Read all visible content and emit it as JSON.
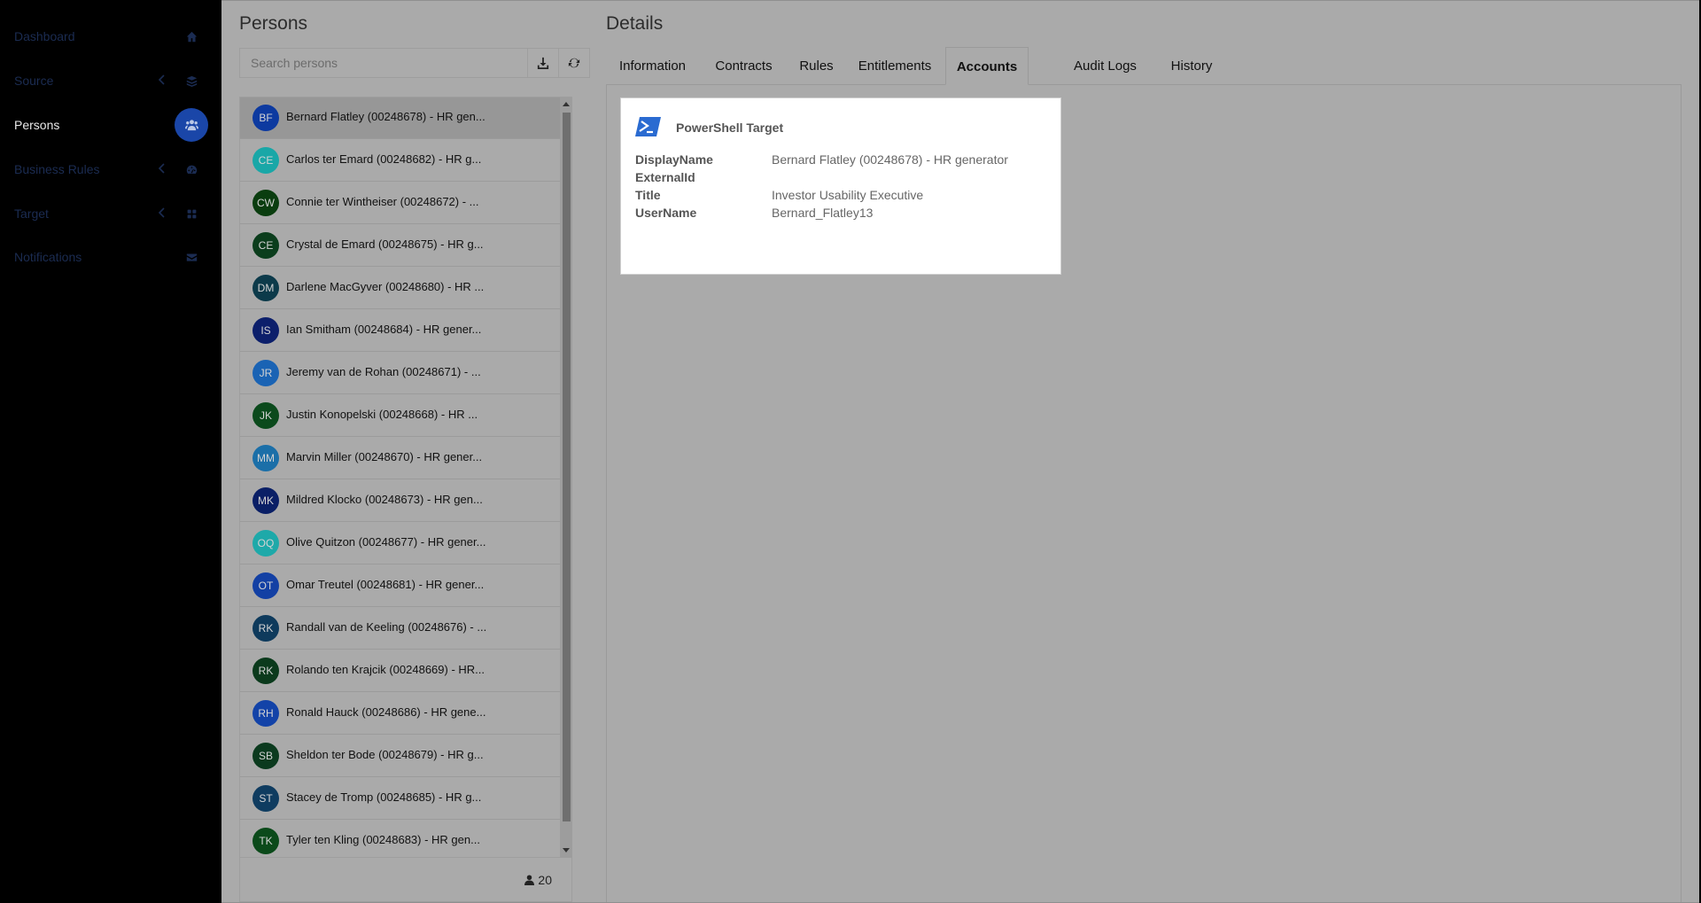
{
  "sidebar": {
    "items": [
      {
        "label": "Dashboard",
        "icon": "home-icon",
        "chevron": false,
        "active": false
      },
      {
        "label": "Source",
        "icon": "database-icon",
        "chevron": true,
        "active": false
      },
      {
        "label": "Persons",
        "icon": "users-icon",
        "chevron": false,
        "active": true
      },
      {
        "label": "Business Rules",
        "icon": "gauge-icon",
        "chevron": true,
        "active": false
      },
      {
        "label": "Target",
        "icon": "grid-icon",
        "chevron": true,
        "active": false
      },
      {
        "label": "Notifications",
        "icon": "envelope-icon",
        "chevron": false,
        "active": false
      }
    ]
  },
  "persons": {
    "title": "Persons",
    "search_placeholder": "Search persons",
    "download_icon": "download-icon",
    "refresh_icon": "refresh-icon",
    "count": "20",
    "list": [
      {
        "initials": "BF",
        "label": "Bernard Flatley (00248678) - HR gen...",
        "color": "#0d3aa0",
        "selected": true
      },
      {
        "initials": "CE",
        "label": "Carlos ter Emard (00248682) - HR g...",
        "color": "#19a7a7",
        "selected": false
      },
      {
        "initials": "CW",
        "label": "Connie ter Wintheiser (00248672) - ...",
        "color": "#0a3d0f",
        "selected": false
      },
      {
        "initials": "CE",
        "label": "Crystal de Emard (00248675) - HR g...",
        "color": "#0b3d1c",
        "selected": false
      },
      {
        "initials": "DM",
        "label": "Darlene MacGyver (00248680) - HR ...",
        "color": "#0c3a4a",
        "selected": false
      },
      {
        "initials": "IS",
        "label": "Ian Smitham (00248684) - HR gener...",
        "color": "#0c1f6b",
        "selected": false
      },
      {
        "initials": "JR",
        "label": "Jeremy van de Rohan (00248671) - ...",
        "color": "#1a63b4",
        "selected": false
      },
      {
        "initials": "JK",
        "label": "Justin Konopelski (00248668) - HR ...",
        "color": "#0b4a1c",
        "selected": false
      },
      {
        "initials": "MM",
        "label": "Marvin Miller (00248670) - HR gener...",
        "color": "#1b6fa8",
        "selected": false
      },
      {
        "initials": "MK",
        "label": "Mildred Klocko (00248673) - HR gen...",
        "color": "#0a1f66",
        "selected": false
      },
      {
        "initials": "OQ",
        "label": "Olive Quitzon (00248677) - HR gener...",
        "color": "#1ea9a9",
        "selected": false
      },
      {
        "initials": "OT",
        "label": "Omar Treutel (00248681) - HR gener...",
        "color": "#1340a4",
        "selected": false
      },
      {
        "initials": "RK",
        "label": "Randall van de Keeling (00248676) - ...",
        "color": "#0e3a5c",
        "selected": false
      },
      {
        "initials": "RK",
        "label": "Rolando ten Krajcik (00248669) - HR...",
        "color": "#0b3a1c",
        "selected": false
      },
      {
        "initials": "RH",
        "label": "Ronald Hauck (00248686) - HR gene...",
        "color": "#1343a8",
        "selected": false
      },
      {
        "initials": "SB",
        "label": "Sheldon ter Bode (00248679) - HR g...",
        "color": "#0b3a1e",
        "selected": false
      },
      {
        "initials": "ST",
        "label": "Stacey de Tromp (00248685) - HR g...",
        "color": "#0f3c60",
        "selected": false
      },
      {
        "initials": "TK",
        "label": "Tyler ten Kling (00248683) - HR gen...",
        "color": "#0b4a1a",
        "selected": false
      }
    ]
  },
  "details": {
    "title": "Details",
    "tabs": [
      {
        "label": "Information",
        "active": false
      },
      {
        "label": "Contracts",
        "active": false
      },
      {
        "label": "Rules",
        "active": false
      },
      {
        "label": "Entitlements",
        "active": false
      },
      {
        "label": "Accounts",
        "active": true
      },
      {
        "label": "Audit Logs",
        "active": false
      },
      {
        "label": "History",
        "active": false
      }
    ],
    "account": {
      "icon": "powershell-icon",
      "title": "PowerShell Target",
      "fields": [
        {
          "label": "DisplayName",
          "value": "Bernard Flatley (00248678) - HR generator"
        },
        {
          "label": "ExternalId",
          "value": ""
        },
        {
          "label": "Title",
          "value": "Investor Usability Executive"
        },
        {
          "label": "UserName",
          "value": "Bernard_Flatley13"
        }
      ]
    }
  }
}
